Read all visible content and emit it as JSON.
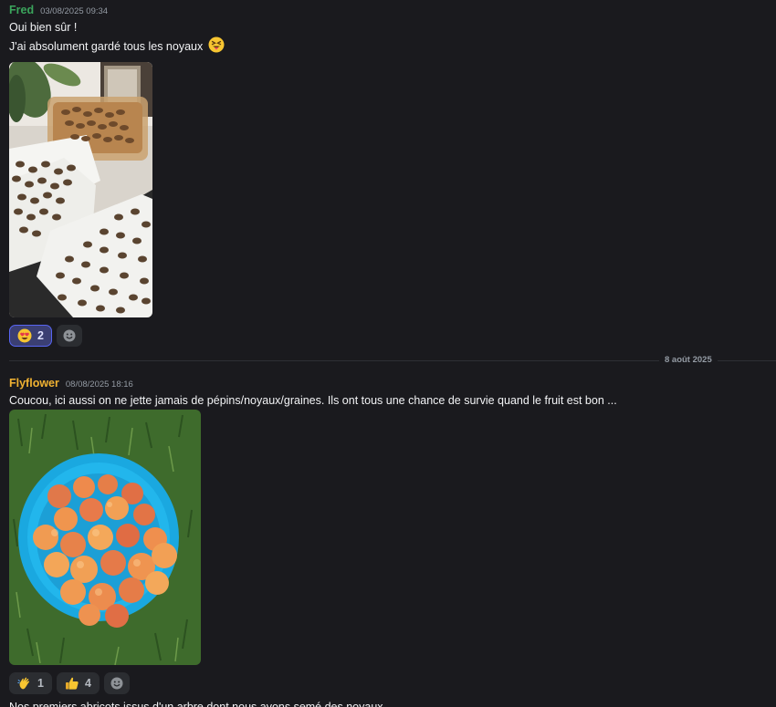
{
  "messages": [
    {
      "author": "Fred",
      "author_color": "#3ba55c",
      "timestamp": "03/08/2025 09:34",
      "lines": [
        "Oui bien sûr !",
        "J'ai absolument gardé tous les noyaux"
      ],
      "inline_emoji": "squinting-tongue-emoji",
      "attachment": "photo-apricot-pits-drying",
      "reactions": [
        {
          "emoji": "heart-eyes-emoji",
          "count": "2",
          "active": true
        }
      ]
    },
    {
      "author": "Flyflower",
      "author_color": "#f0b232",
      "timestamp": "08/08/2025 18:16",
      "lines": [
        "Coucou, ici aussi on ne jette jamais de pépins/noyaux/graines. Ils ont tous une chance de survie quand le fruit est bon ...",
        "Nos premiers abricots issus d'un arbre dont nous avons semé des noyaux"
      ],
      "attachment": "photo-apricots-blue-basket",
      "reactions": [
        {
          "emoji": "waving-hand-emoji",
          "count": "1",
          "active": false
        },
        {
          "emoji": "thumbs-up-emoji",
          "count": "4",
          "active": false
        }
      ]
    }
  ],
  "divider": {
    "label": "8 août 2025"
  },
  "colors": {
    "background": "#1a1a1e",
    "reaction_active_border": "#5865f2",
    "reaction_bg": "#2b2d31"
  }
}
